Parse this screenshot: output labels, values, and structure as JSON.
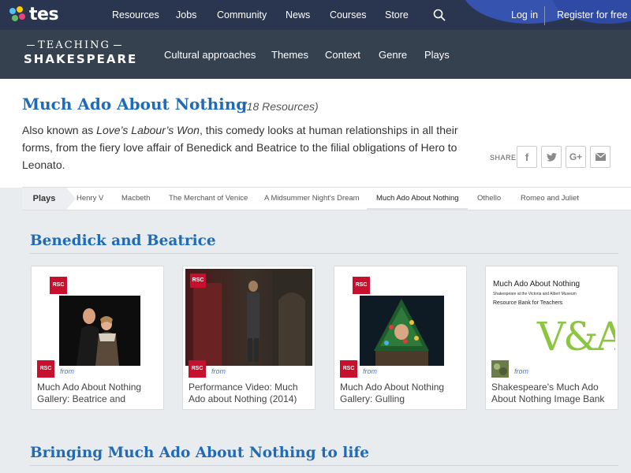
{
  "topnav": {
    "logo_text": "tes",
    "items": [
      "Resources",
      "Jobs",
      "Community",
      "News",
      "Courses",
      "Store"
    ],
    "login": "Log in",
    "register": "Register for free"
  },
  "site": {
    "logo_line1": "TEACHING",
    "logo_line2": "SHAKESPEARE",
    "nav": [
      "Cultural approaches",
      "Themes",
      "Context",
      "Genre",
      "Plays"
    ]
  },
  "header": {
    "title": "Much Ado About Nothing",
    "count": "(18 Resources)",
    "desc_pre": "Also known as ",
    "desc_em": "Love’s Labour’s Won",
    "desc_post": ", this comedy looks at human relationships in all their forms, from the fiery love affair of Benedick and Beatrice to the filial obligations of Hero to Leonato.",
    "share_label": "SHARE",
    "share_buttons": [
      "f",
      "t",
      "G+",
      "mail"
    ]
  },
  "tabs": {
    "label": "Plays",
    "items": [
      "Henry V",
      "Macbeth",
      "The Merchant of Venice",
      "A Midsummer Night's Dream",
      "Much Ado About Nothing",
      "Othello",
      "Romeo and Juliet"
    ],
    "active": "Much Ado About Nothing"
  },
  "sections": [
    {
      "title": "Benedick and Beatrice",
      "cards": [
        {
          "from": "from",
          "title": "Much Ado About Nothing Gallery: Beatrice and",
          "badge": "RSC"
        },
        {
          "from": "from",
          "title": "Performance Video: Much Ado about Nothing (2014)",
          "badge": "RSC"
        },
        {
          "from": "from",
          "title": "Much Ado About Nothing Gallery: Gulling",
          "badge": "RSC"
        },
        {
          "from": "from",
          "title": "Shakespeare's Much Ado About Nothing Image Bank",
          "badge": "",
          "thumb_line1": "Much Ado About Nothing",
          "thumb_line2": "Shakespeare at the Victoria and Albert Museum",
          "thumb_line3": "Resource Bank for Teachers",
          "thumb_logo": "V&A"
        }
      ]
    },
    {
      "title": "Bringing Much Ado About Nothing to life"
    }
  ],
  "colors": {
    "topnav_bg": "#2a3550",
    "site_bar_bg": "#36414f",
    "title_blue": "#1f6bb8",
    "rsc_red": "#c8102e",
    "va_green": "#8cc63f"
  }
}
